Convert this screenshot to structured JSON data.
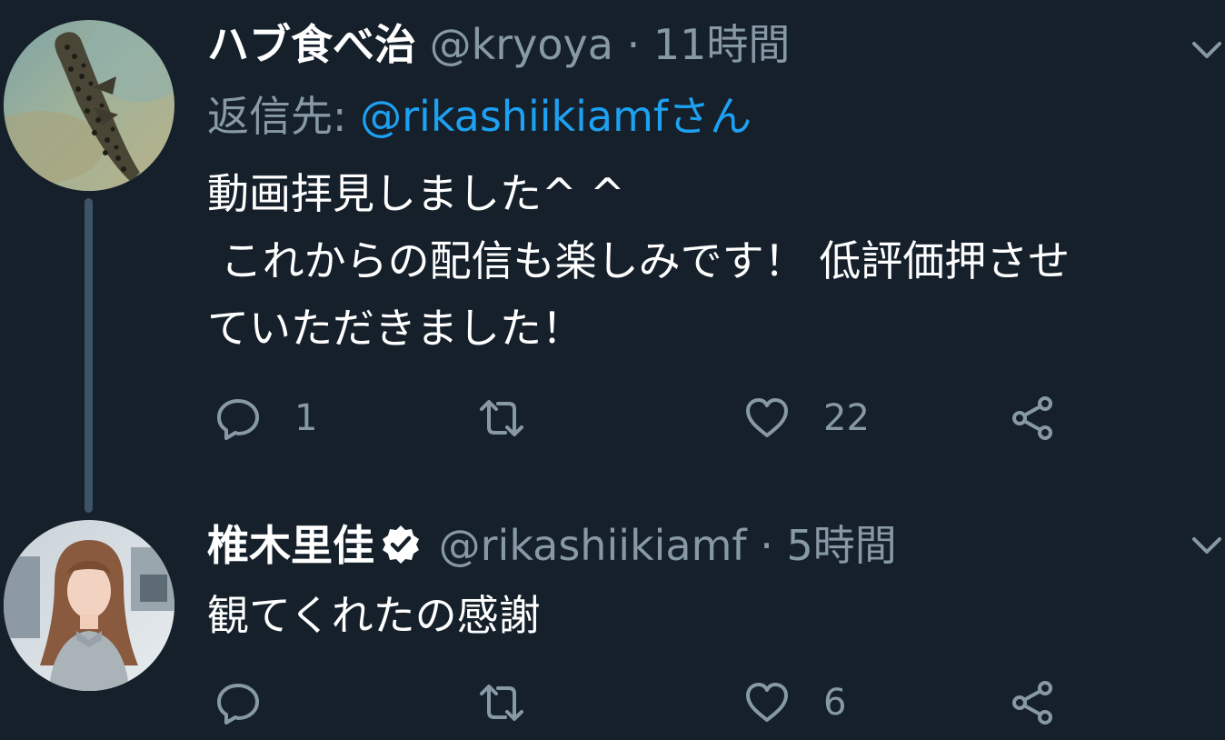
{
  "tweets": [
    {
      "display_name": "ハブ食べ治",
      "handle": "@kryoya",
      "separator": "·",
      "time": "11時間",
      "reply_to_label": "返信先:",
      "reply_to_mention": "@rikashiikiamfさん",
      "body_lines": [
        "動画拝見しました^ ^",
        " これからの配信も楽しみです！ 低評価押させ",
        "ていただきました！"
      ],
      "reply_count": "1",
      "retweet_count": "",
      "like_count": "22",
      "avatar_icon": "pufferfish-photo-avatar",
      "verified": false
    },
    {
      "display_name": "椎木里佳",
      "handle": "@rikashiikiamf",
      "separator": "·",
      "time": "5時間",
      "body_lines": [
        "観てくれたの感謝"
      ],
      "reply_count": "",
      "retweet_count": "",
      "like_count": "6",
      "avatar_icon": "woman-photo-avatar",
      "verified": true
    }
  ],
  "icons": {
    "reply": "reply-icon",
    "retweet": "retweet-icon",
    "like": "heart-icon",
    "share": "share-icon",
    "menu": "chevron-down-icon",
    "verified": "verified-badge-icon"
  },
  "colors": {
    "background": "#15202b",
    "text": "#ffffff",
    "secondary": "#8899a6",
    "link": "#1da1f2",
    "thread_line": "#3d5466"
  }
}
